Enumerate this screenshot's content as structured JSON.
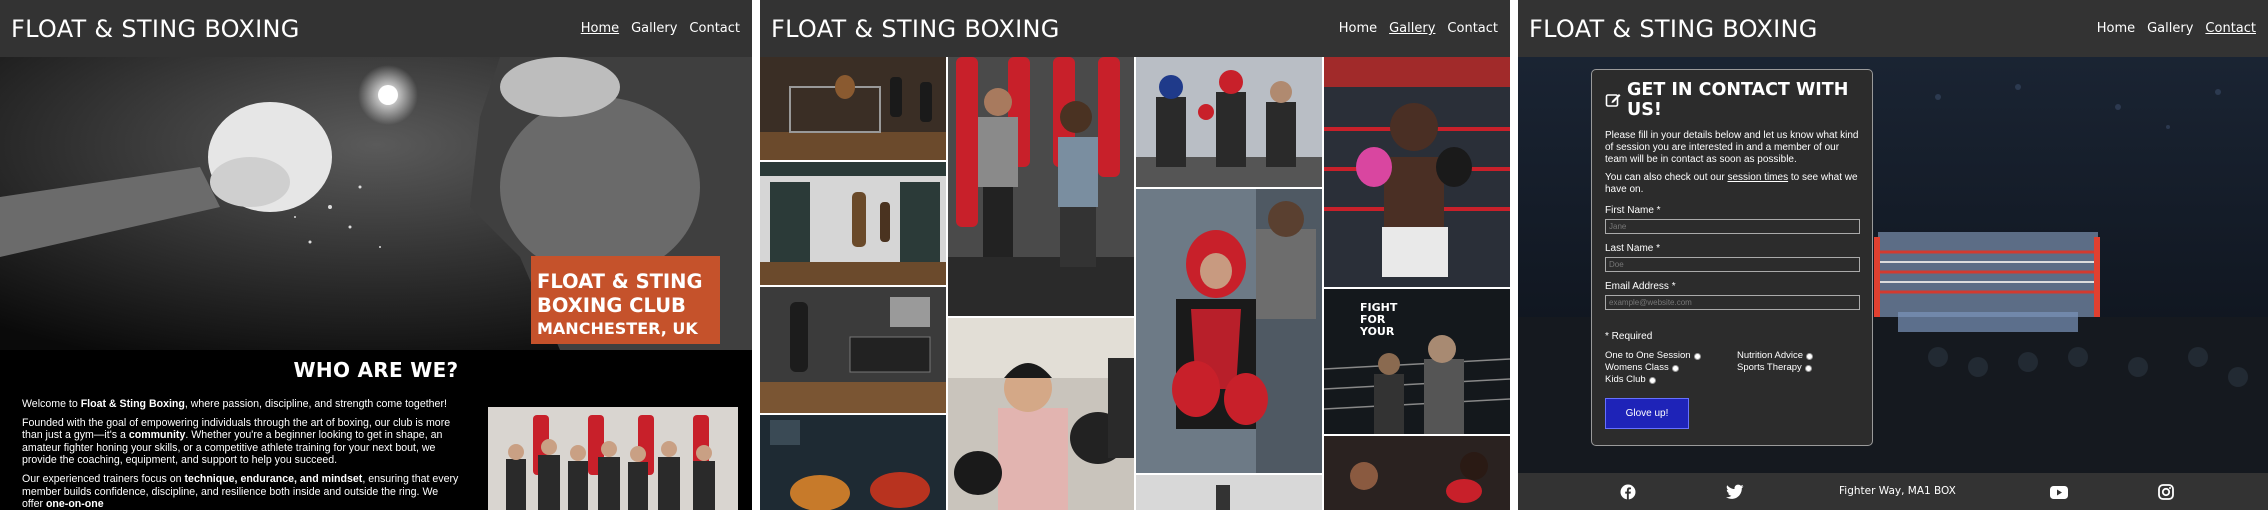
{
  "brand": "FLOAT & STING BOXING",
  "nav": {
    "home": "Home",
    "gallery": "Gallery",
    "contact": "Contact"
  },
  "hero": {
    "line1": "FLOAT & STING",
    "line2": "BOXING CLUB",
    "line3": "MANCHESTER, UK"
  },
  "about": {
    "title": "WHO ARE WE?",
    "p1_a": "Welcome to ",
    "p1_b": "Float & Sting Boxing",
    "p1_c": ", where passion, discipline, and strength come together!",
    "p2_a": "Founded with the goal of empowering individuals through the art of boxing, our club is more than just a gym—it's a ",
    "p2_b": "community",
    "p2_c": ". Whether you're a beginner looking to get in shape, an amateur fighter honing your skills, or a competitive athlete training for your next bout, we provide the coaching, equipment, and support to help you succeed.",
    "p3_a": "Our experienced trainers focus on ",
    "p3_b": "technique, endurance, and mindset",
    "p3_c": ", ensuring that every member builds confidence, discipline, and resilience both inside and outside the ring. We offer ",
    "p3_d": "one-on-one"
  },
  "gallery": {
    "poster_text": "FIGHT FOR YOUR"
  },
  "contact": {
    "title": "GET IN CONTACT WITH US!",
    "intro": "Please fill in your details below and let us know what kind of session you are interested in and a member of our team will be in contact as soon as possible.",
    "intro2_a": "You can also check out our ",
    "intro2_link": "session times",
    "intro2_b": " to see what we have on.",
    "first_label": "First Name *",
    "first_placeholder": "Jane",
    "last_label": "Last Name *",
    "last_placeholder": "Doe",
    "email_label": "Email Address *",
    "email_placeholder": "example@website.com",
    "required_note": "* Required",
    "options": [
      "One to One Session",
      "Nutrition Advice",
      "Womens Class",
      "Sports Therapy",
      "Kids Club"
    ],
    "button": "Glove up!"
  },
  "footer": {
    "address": "Fighter Way, MA1 BOX",
    "icons": [
      "facebook-icon",
      "twitter-icon",
      "youtube-icon",
      "instagram-icon"
    ]
  },
  "colors": {
    "nav": "#333333",
    "hero_card": "#c5522b",
    "button": "#1e23b8",
    "boxing_red": "#c8202a"
  }
}
